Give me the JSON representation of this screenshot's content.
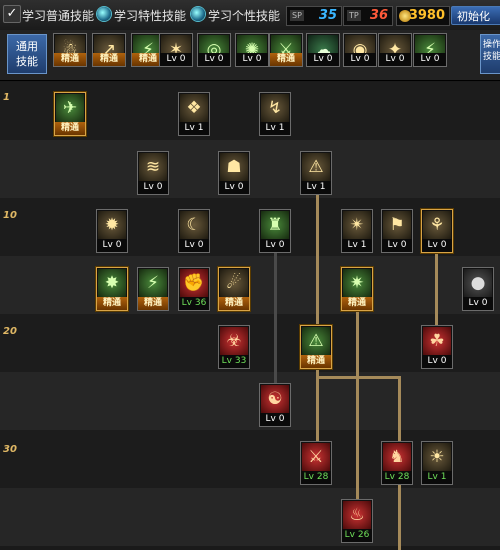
{
  "tabs": [
    {
      "label": "学习普通技能",
      "selected": true
    },
    {
      "label": "学习特性技能",
      "selected": false
    },
    {
      "label": "学习个性技能",
      "selected": false
    }
  ],
  "points": [
    {
      "tag": "SP",
      "value": "35",
      "color": "#3ab6ff"
    },
    {
      "tag": "TP",
      "value": "36",
      "color": "#ff5a3a"
    }
  ],
  "gold": "3980",
  "reset_label": "初始化",
  "common_label_line1": "通用",
  "common_label_line2": "技能",
  "side_label": "操作技能",
  "common_skills": [
    {
      "icon": "☃",
      "tone": "gold",
      "level": "精通",
      "kind": "master"
    },
    {
      "icon": "↗",
      "tone": "gold",
      "level": "精通",
      "kind": "master"
    },
    {
      "icon": "⚡",
      "tone": "green",
      "level": "精通",
      "kind": "master"
    },
    {
      "icon": "✶",
      "tone": "gold",
      "level": "Lv 0",
      "kind": "plain"
    },
    {
      "icon": "◎",
      "tone": "green",
      "level": "Lv 0",
      "kind": "plain"
    },
    {
      "icon": "✺",
      "tone": "green",
      "level": "Lv 0",
      "kind": "plain"
    },
    {
      "icon": "⚔",
      "tone": "green",
      "level": "精通",
      "kind": "master"
    },
    {
      "icon": "☁",
      "tone": "teal",
      "level": "Lv 0",
      "kind": "plain"
    },
    {
      "icon": "◉",
      "tone": "gold",
      "level": "Lv 0",
      "kind": "plain"
    },
    {
      "icon": "✦",
      "tone": "gold",
      "level": "Lv 0",
      "kind": "plain"
    },
    {
      "icon": "⚡",
      "tone": "green",
      "level": "Lv 0",
      "kind": "plain"
    }
  ],
  "level_markers": [
    "1",
    "10",
    "20",
    "30"
  ],
  "tree_skills": [
    {
      "icon": "✈",
      "tone": "green",
      "level": "精通",
      "kind": "master",
      "gold": true
    },
    {
      "icon": "❖",
      "tone": "gold",
      "level": "Lv 1",
      "kind": "plain",
      "gold": false
    },
    {
      "icon": "↯",
      "tone": "gold",
      "level": "Lv 1",
      "kind": "plain",
      "gold": false
    },
    {
      "icon": "≋",
      "tone": "gold",
      "level": "Lv 0",
      "kind": "plain",
      "gold": false
    },
    {
      "icon": "☗",
      "tone": "gold",
      "level": "Lv 0",
      "kind": "plain",
      "gold": false
    },
    {
      "icon": "⚠",
      "tone": "gold",
      "level": "Lv 1",
      "kind": "plain",
      "gold": false
    },
    {
      "icon": "✹",
      "tone": "gold",
      "level": "Lv 0",
      "kind": "plain",
      "gold": false
    },
    {
      "icon": "☾",
      "tone": "gold",
      "level": "Lv 0",
      "kind": "plain",
      "gold": false
    },
    {
      "icon": "♜",
      "tone": "green",
      "level": "Lv 0",
      "kind": "plain",
      "gold": false
    },
    {
      "icon": "✴",
      "tone": "gold",
      "level": "Lv 1",
      "kind": "plain",
      "gold": false
    },
    {
      "icon": "⚑",
      "tone": "gold",
      "level": "Lv 0",
      "kind": "plain",
      "gold": false
    },
    {
      "icon": "⚘",
      "tone": "gold",
      "level": "Lv 0",
      "kind": "plain",
      "gold": true
    },
    {
      "icon": "✸",
      "tone": "green",
      "level": "精通",
      "kind": "master",
      "gold": true
    },
    {
      "icon": "⚡",
      "tone": "green",
      "level": "精通",
      "kind": "master",
      "gold": false
    },
    {
      "icon": "✊",
      "tone": "red",
      "level": "Lv 36",
      "kind": "green",
      "gold": false
    },
    {
      "icon": "☄",
      "tone": "gold",
      "level": "精通",
      "kind": "master",
      "gold": true
    },
    {
      "icon": "✷",
      "tone": "green",
      "level": "精通",
      "kind": "master",
      "gold": true
    },
    {
      "icon": "●",
      "tone": "gray",
      "level": "Lv 0",
      "kind": "plain",
      "gold": false
    },
    {
      "icon": "☣",
      "tone": "red",
      "level": "Lv 33",
      "kind": "green",
      "gold": false
    },
    {
      "icon": "⚠",
      "tone": "green",
      "level": "精通",
      "kind": "master",
      "gold": true
    },
    {
      "icon": "☘",
      "tone": "red",
      "level": "Lv 0",
      "kind": "plain",
      "gold": false
    },
    {
      "icon": "☯",
      "tone": "red",
      "level": "Lv 0",
      "kind": "plain",
      "gold": false
    },
    {
      "icon": "⚔",
      "tone": "red",
      "level": "Lv 28",
      "kind": "green",
      "gold": false
    },
    {
      "icon": "♞",
      "tone": "red",
      "level": "Lv 28",
      "kind": "green",
      "gold": false
    },
    {
      "icon": "☀",
      "tone": "gold",
      "level": "Lv 1",
      "kind": "green",
      "gold": false
    },
    {
      "icon": "♨",
      "tone": "red",
      "level": "Lv 26",
      "kind": "green",
      "gold": false
    }
  ]
}
